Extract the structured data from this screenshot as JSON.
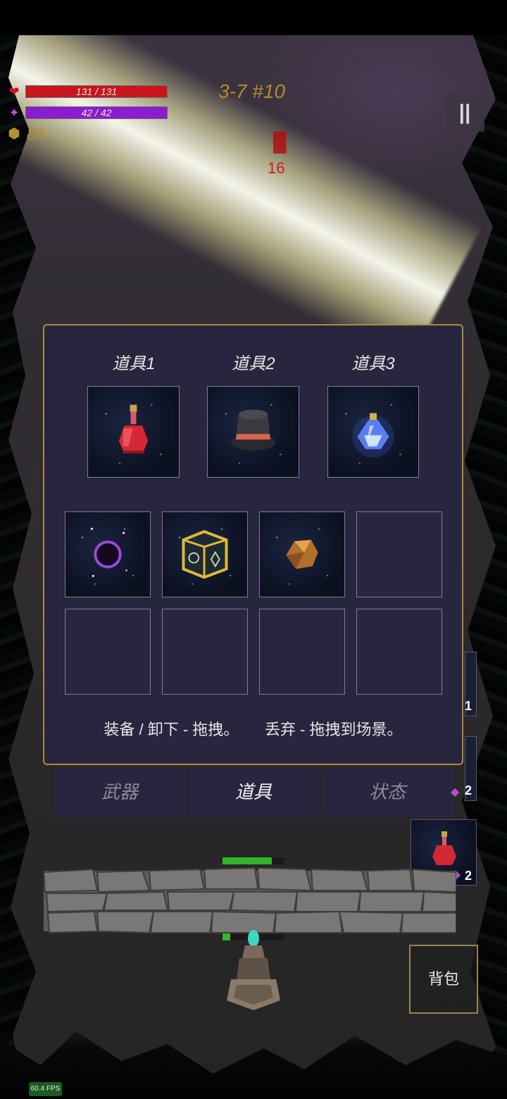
{
  "hud": {
    "hp_text": "131 / 131",
    "hp_fraction": 1.0,
    "mp_text": "42 / 42",
    "mp_fraction": 1.0,
    "gold": "84",
    "wave": "3-7 #10",
    "pause_icon": "pause-icon",
    "colors": {
      "hp": "#c8161c",
      "mp": "#8b1ccf",
      "gold": "#b38f2e"
    }
  },
  "damage_numbers": [
    "16"
  ],
  "inventory": {
    "equip_labels": [
      "道具1",
      "道具2",
      "道具3"
    ],
    "equipped": [
      "red-potion-icon",
      "top-hat-icon",
      "blue-potion-icon"
    ],
    "grid": [
      "dark-ring-icon",
      "rune-cube-icon",
      "amber-gem-icon",
      "",
      "",
      "",
      "",
      ""
    ],
    "hint_left": "装备 / 卸下 - 拖拽。",
    "hint_right": "丢弃 - 拖拽到场景。",
    "accent": "#b08a3a"
  },
  "tabs": [
    {
      "label": "武器",
      "active": false
    },
    {
      "label": "道具",
      "active": true
    },
    {
      "label": "状态",
      "active": false
    }
  ],
  "quick_slots": [
    {
      "count": "1"
    },
    {
      "count": "2"
    },
    {
      "count": "2",
      "item": "red-potion-icon"
    }
  ],
  "bag_label": "背包",
  "wall_hp_fraction": 0.8,
  "tower_hp_fraction": 0.12,
  "fps": "60.4 FPS"
}
